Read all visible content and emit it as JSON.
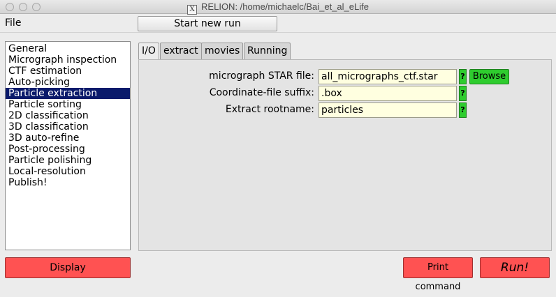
{
  "window": {
    "title": "RELION: /home/michaelc/Bai_et_al_eLife",
    "x_icon": "X"
  },
  "menubar": {
    "file": "File"
  },
  "toolbar": {
    "start_new_run": "Start new run"
  },
  "jobs": {
    "items": [
      "General",
      "Micrograph inspection",
      "CTF estimation",
      "Auto-picking",
      "Particle extraction",
      "Particle sorting",
      "2D classification",
      "3D classification",
      "3D auto-refine",
      "Post-processing",
      "Particle polishing",
      "Local-resolution",
      "Publish!"
    ],
    "selected": "Particle extraction"
  },
  "tabs": [
    "I/O",
    "extract",
    "movies",
    "Running"
  ],
  "active_tab": "I/O",
  "form": {
    "micrograph_label": "micrograph STAR file:",
    "micrograph_value": "all_micrographs_ctf.star",
    "coord_label": "Coordinate-file suffix:",
    "coord_value": ".box",
    "rootname_label": "Extract rootname:",
    "rootname_value": "particles",
    "help_mark": "?",
    "browse_label": "Browse"
  },
  "buttons": {
    "display": "Display",
    "print_command": "Print command",
    "run": "Run!"
  },
  "colors": {
    "field_bg": "#ffffe0",
    "help_green": "#2ecc2e",
    "run_red": "#ff5252",
    "selection": "#0a1a6b"
  }
}
